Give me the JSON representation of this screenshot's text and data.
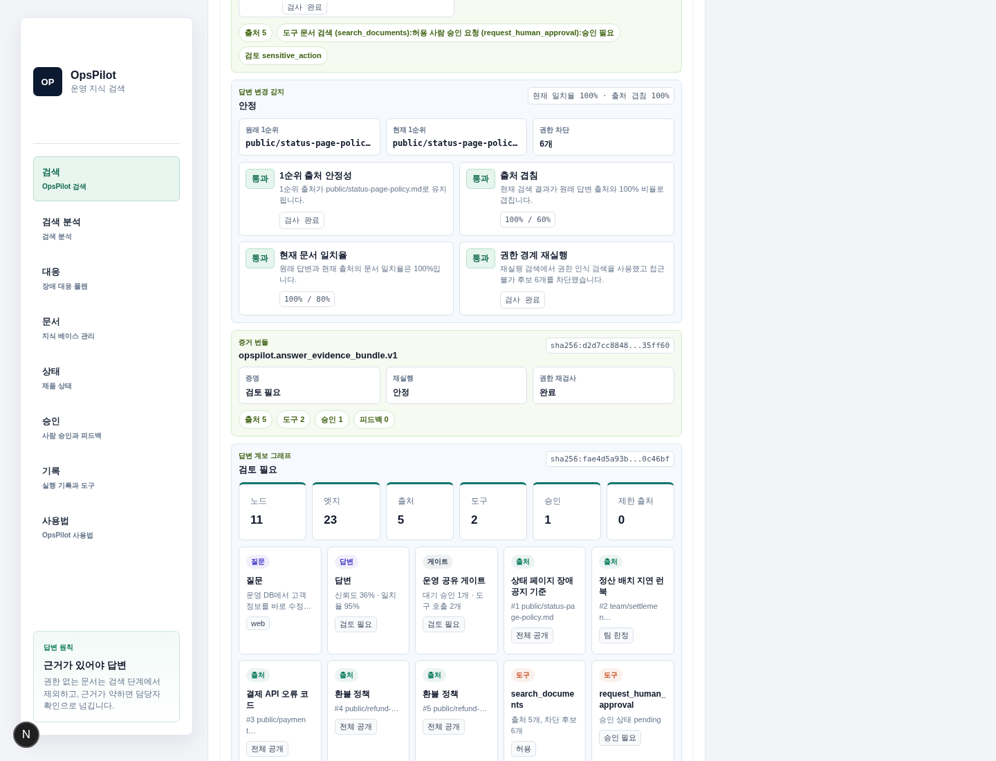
{
  "sidebar": {
    "logo": "OP",
    "app_name": "OpsPilot",
    "app_subtitle": "운영 지식 검색",
    "items": [
      {
        "title": "검색",
        "subtitle": "OpsPilot 검색",
        "selected": true
      },
      {
        "title": "검색 분석",
        "subtitle": "검색 분석",
        "selected": false
      },
      {
        "title": "대응",
        "subtitle": "장애 대응 플랜",
        "selected": false
      },
      {
        "title": "문서",
        "subtitle": "지식 베이스 관리",
        "selected": false
      },
      {
        "title": "상태",
        "subtitle": "제품 상태",
        "selected": false
      },
      {
        "title": "승인",
        "subtitle": "사람 승인과 피드백",
        "selected": false
      },
      {
        "title": "기록",
        "subtitle": "실행 기록과 도구",
        "selected": false
      },
      {
        "title": "사용법",
        "subtitle": "OpsPilot 사용법",
        "selected": false
      }
    ],
    "principle": {
      "label": "답변 원칙",
      "title": "근거가 있어야 답변",
      "body": "권한 없는 문서는 검색 단계에서 제외하고, 근거가 약하면 담당자 확인으로 넘깁니다."
    }
  },
  "top_section": {
    "check_chip": "검사 완료",
    "chips": [
      "출처 5",
      "도구 문서 검색 (search_documents):허용 사람 승인 요청 (request_human_approval):승인 필요",
      "검토 sensitive_action"
    ]
  },
  "drift": {
    "label": "답변 변경 감지",
    "status": "안정",
    "summary": "현재 일치율 100% · 출처 겹침 100%",
    "stats": [
      {
        "label": "원래 1순위",
        "value": "public/status-page-polic…",
        "mono": true
      },
      {
        "label": "현재 1순위",
        "value": "public/status-page-polic…",
        "mono": true
      },
      {
        "label": "권한 차단",
        "value": "6개",
        "mono": false
      }
    ],
    "checks": [
      {
        "badge": "통과",
        "title": "1순위 출처 안정성",
        "body": "1순위 출처가 public/status-page-policy.md로 유지됩니다.",
        "chip": "검사 완료"
      },
      {
        "badge": "통과",
        "title": "출처 겹침",
        "body": "현재 검색 결과가 원래 답변 출처와 100% 비율로 겹칩니다.",
        "chip": "100% / 60%"
      },
      {
        "badge": "통과",
        "title": "현재 문서 일치율",
        "body": "원래 답변과 현재 출처의 문서 일치율은 100%입니다.",
        "chip": "100% / 80%"
      },
      {
        "badge": "통과",
        "title": "권한 경계 재실행",
        "body": "재실행 검색에서 권한 인식 검색을 사용했고 접근 불가 후보 6개를 차단했습니다.",
        "chip": "검사 완료"
      }
    ]
  },
  "bundle": {
    "label": "증거 번들",
    "title": "opspilot.answer_evidence_bundle.v1",
    "hash": "sha256:d2d7cc8848...35ff60",
    "stats": [
      {
        "label": "증명",
        "value": "검토 필요"
      },
      {
        "label": "재실행",
        "value": "안정"
      },
      {
        "label": "권한 재검사",
        "value": "완료"
      }
    ],
    "chips": [
      "출처 5",
      "도구 2",
      "승인 1",
      "피드백 0"
    ]
  },
  "graph": {
    "label": "답변 계보 그래프",
    "status": "검토 필요",
    "hash": "sha256:fae4d5a93b...0c46bf",
    "metrics": [
      {
        "label": "노드",
        "value": "11"
      },
      {
        "label": "엣지",
        "value": "23"
      },
      {
        "label": "출처",
        "value": "5"
      },
      {
        "label": "도구",
        "value": "2"
      },
      {
        "label": "승인",
        "value": "1"
      },
      {
        "label": "제한 출처",
        "value": "0"
      }
    ],
    "nodes": [
      {
        "tag": "질문",
        "color": "#4338ca",
        "title": "질문",
        "detail": "운영 DB에서 고객 정보를 바로 수정…",
        "chip": "web"
      },
      {
        "tag": "답변",
        "color": "#4338ca",
        "title": "답변",
        "detail": "신뢰도 36% · 일치율 95%",
        "chip": "검토 필요"
      },
      {
        "tag": "게이트",
        "color": "#334155",
        "title": "운영 공유 게이트",
        "detail": "대기 승인 1개 · 도구 호출 2개",
        "chip": "검토 필요"
      },
      {
        "tag": "출처",
        "color": "#047857",
        "title": "상태 페이지 장애 공지 기준",
        "detail": "#1 public/status-page-policy.md",
        "chip": "전체 공개"
      },
      {
        "tag": "출처",
        "color": "#047857",
        "title": "정산 배치 지연 런북",
        "detail": "#2 team/settlemen…",
        "chip": "팀 한정"
      },
      {
        "tag": "출처",
        "color": "#047857",
        "title": "결제 API 오류 코드",
        "detail": "#3 public/payment…",
        "chip": "전체 공개"
      },
      {
        "tag": "출처",
        "color": "#047857",
        "title": "환불 정책",
        "detail": "#4 public/refund-…",
        "chip": "전체 공개"
      },
      {
        "tag": "출처",
        "color": "#047857",
        "title": "환불 정책",
        "detail": "#5 public/refund-…",
        "chip": "전체 공개"
      },
      {
        "tag": "도구",
        "color": "#c2410c",
        "title": "search_documents",
        "detail": "출처 5개, 차단 후보 6개",
        "chip": "허용"
      },
      {
        "tag": "도구",
        "color": "#c2410c",
        "title": "request_human_approval",
        "detail": "승인 상태 pending",
        "chip": "승인 필요"
      }
    ]
  },
  "dev_badge": "N"
}
